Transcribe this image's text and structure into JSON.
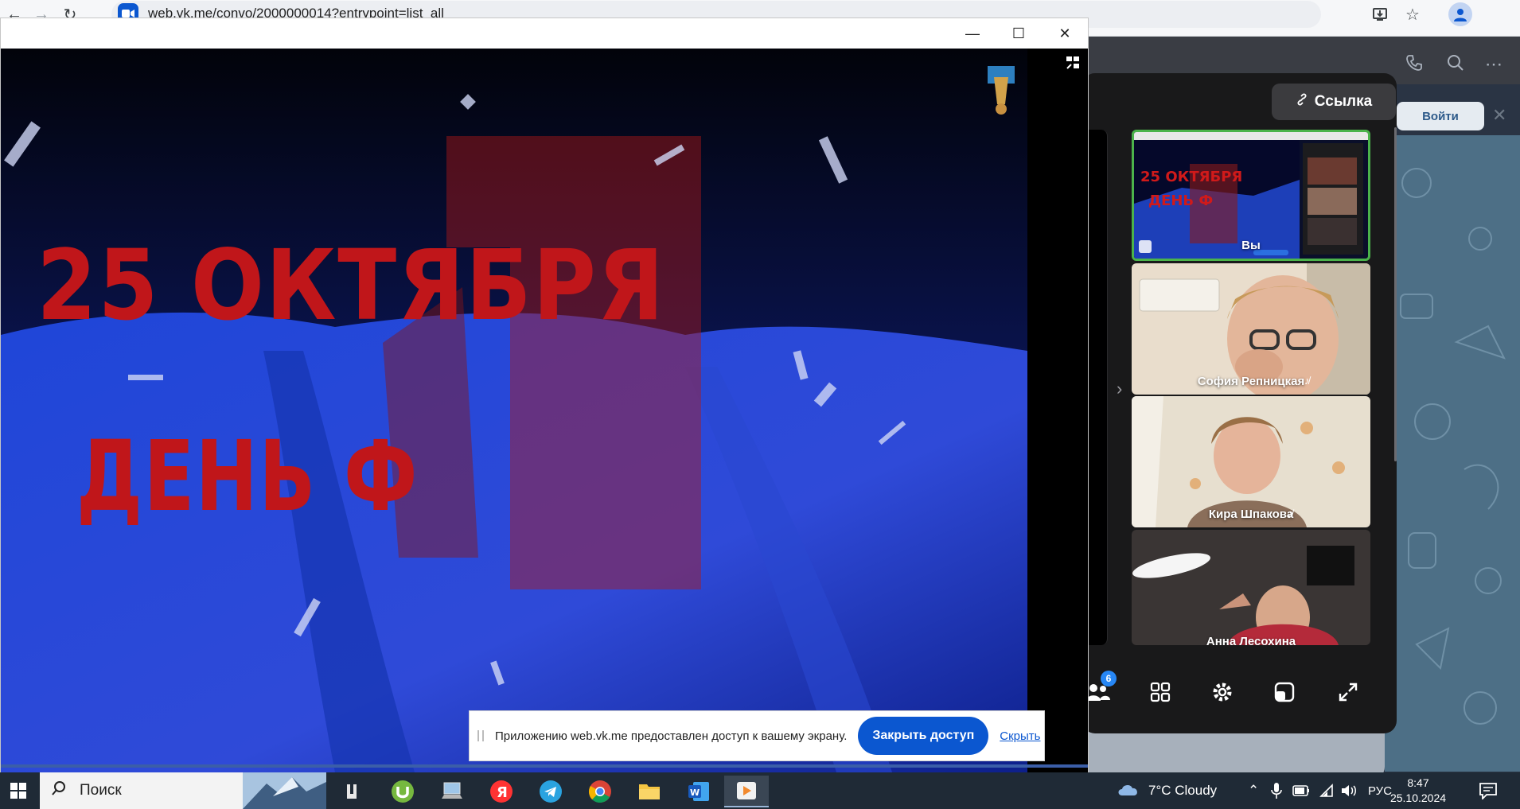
{
  "browser": {
    "url": "web.vk.me/convo/2000000014?entrypoint=list_all"
  },
  "vk_page": {
    "login_label": "Войти"
  },
  "call": {
    "link_button_label": "Ссылка",
    "self_label": "Вы",
    "participants": [
      {
        "name": "София Репницкая"
      },
      {
        "name": "Кира Шпакова"
      },
      {
        "name": "Анна Лесохина"
      }
    ],
    "participants_count": "6",
    "thumbnail_text": [
      "25 ОКТЯБРЯ",
      "ДЕНЬ Ф"
    ]
  },
  "video": {
    "line1": "25 ОКТЯБРЯ",
    "line2": "ДЕНЬ Ф"
  },
  "share_bar": {
    "message": "Приложению web.vk.me предоставлен доступ к вашему экрану.",
    "close_label": "Закрыть доступ",
    "hide_label": "Скрыть"
  },
  "taskbar": {
    "search_label": "Поиск",
    "weather": "7°C  Cloudy",
    "language": "РУС",
    "time": "8:47",
    "date": "25.10.2024"
  },
  "colors": {
    "accent_blue": "#0b57d0",
    "self_border": "#4bb34b",
    "title_red": "#c0161a",
    "badge_blue": "#2787f5"
  }
}
